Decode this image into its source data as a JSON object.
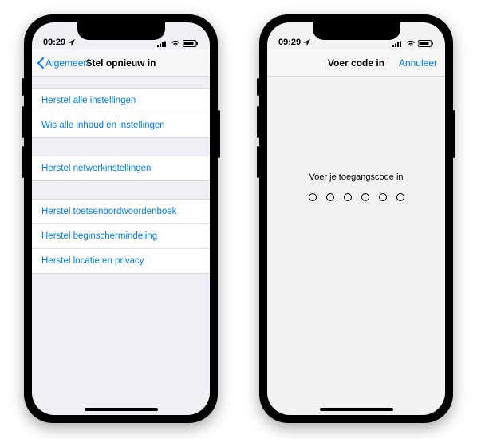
{
  "status": {
    "time": "09:29",
    "location_icon": "location-arrow"
  },
  "left": {
    "nav": {
      "back_label": "Algemeen",
      "title": "Stel opnieuw in"
    },
    "groups": [
      {
        "items": [
          {
            "label": "Herstel alle instellingen"
          },
          {
            "label": "Wis alle inhoud en instellingen"
          }
        ]
      },
      {
        "items": [
          {
            "label": "Herstel netwerkinstellingen"
          }
        ]
      },
      {
        "items": [
          {
            "label": "Herstel toetsenbordwoordenboek"
          },
          {
            "label": "Herstel beginschermindeling"
          },
          {
            "label": "Herstel locatie en privacy"
          }
        ]
      }
    ]
  },
  "right": {
    "nav": {
      "title": "Voer code in",
      "cancel_label": "Annuleer"
    },
    "prompt": "Voer je toegangscode in",
    "passcode_length": 6
  }
}
